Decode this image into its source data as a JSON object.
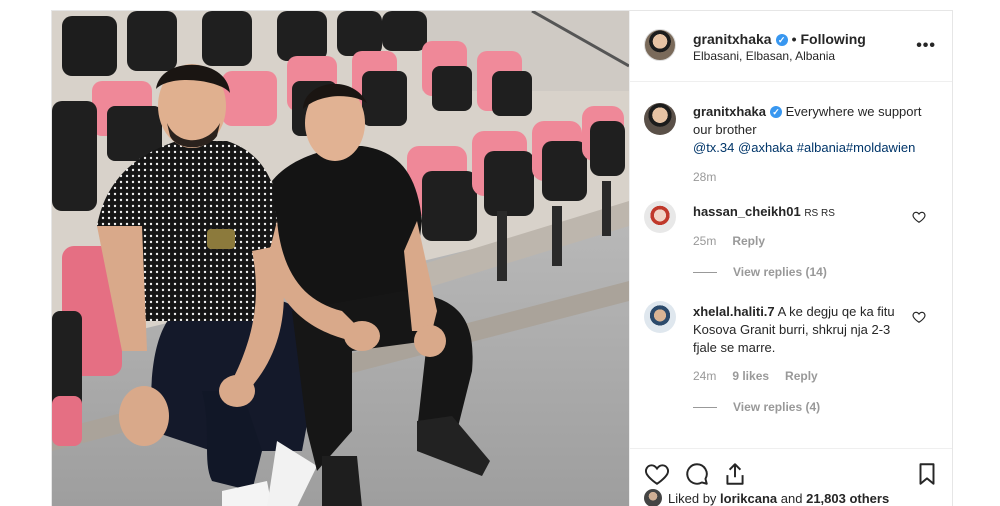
{
  "post": {
    "author": "granitxhaka",
    "follow_state": "Following",
    "separator": "•",
    "location": "Elbasani, Elbasan, Albania",
    "more_label": "•••"
  },
  "caption": {
    "username": "granitxhaka",
    "text_before": "Everywhere we support our brother",
    "mention1": "@tx.34",
    "mention2": "@axhaka",
    "hashtags": "#albania#moldawien",
    "time": "28m"
  },
  "comments": [
    {
      "username": "hassan_cheikh01",
      "text": "RS RS",
      "time": "25m",
      "reply_label": "Reply",
      "view_replies": "View replies (14)"
    },
    {
      "username": "xhelal.haliti.7",
      "text": "A ke degju qe ka fitu Kosova Granit burri, shkruj nja 2-3 fjale se marre.",
      "time": "24m",
      "likes": "9 likes",
      "reply_label": "Reply",
      "view_replies": "View replies (4)"
    }
  ],
  "likes": {
    "prefix": "Liked by",
    "user": "lorikcana",
    "and": "and",
    "count": "21,803 others"
  },
  "icons": [
    "verified-badge-icon",
    "more-options-icon",
    "heart-icon",
    "comment-icon",
    "share-icon",
    "bookmark-icon"
  ],
  "colors": {
    "link": "#003569",
    "verified": "#3897f0",
    "muted": "#999999",
    "seat_pink": "#e56f83"
  }
}
